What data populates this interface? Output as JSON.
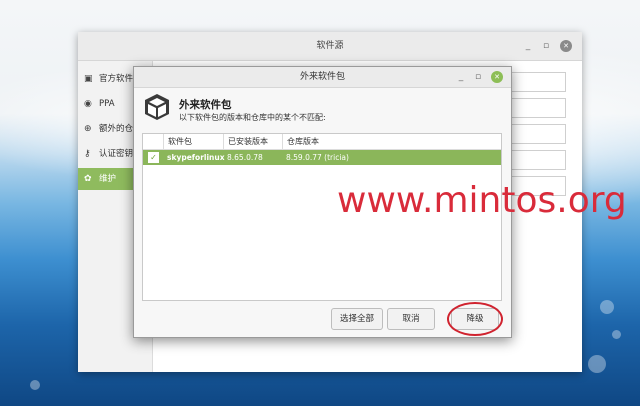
{
  "main_window": {
    "title": "软件源",
    "sidebar": [
      {
        "icon": "box-icon",
        "glyph": "▣",
        "label": "官方软件仓"
      },
      {
        "icon": "ppa-icon",
        "glyph": "◉",
        "label": "PPA"
      },
      {
        "icon": "extra-icon",
        "glyph": "⊕",
        "label": "额外的仓"
      },
      {
        "icon": "key-icon",
        "glyph": "⚷",
        "label": "认证密钥"
      },
      {
        "icon": "maintenance-icon",
        "glyph": "✿",
        "label": "维护"
      }
    ],
    "selected_index": 4
  },
  "dialog": {
    "title": "外来软件包",
    "heading": "外来软件包",
    "subtitle": "以下软件包的版本和仓库中的某个不匹配:",
    "columns": [
      "软件包",
      "已安装版本",
      "仓库版本"
    ],
    "rows": [
      {
        "checked": true,
        "package": "skypeforlinux",
        "installed": "8.65.0.78",
        "repo": "8.59.0.77 (tricia)"
      }
    ],
    "buttons": {
      "select_all": "选择全部",
      "cancel": "取消",
      "downgrade": "降级"
    }
  },
  "watermark": "www.mintos.org"
}
